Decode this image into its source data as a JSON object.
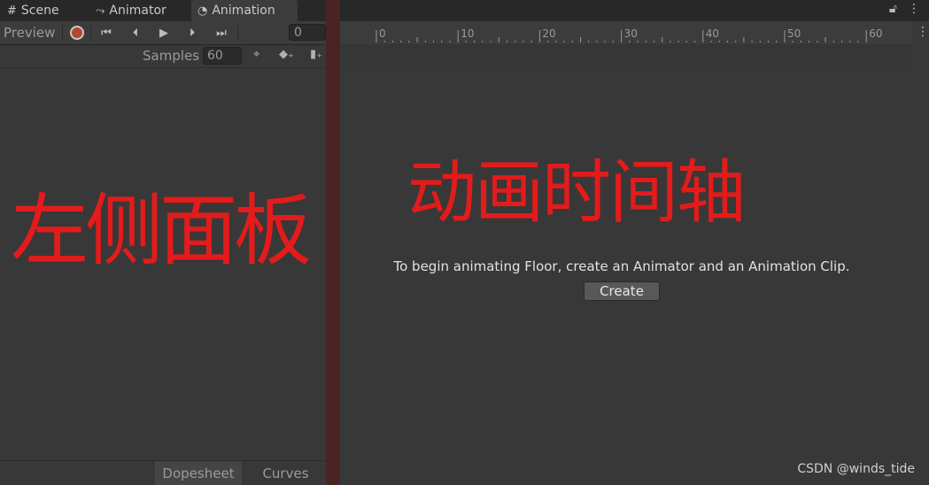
{
  "tabs": [
    {
      "label": "Scene",
      "icon": "grid-icon"
    },
    {
      "label": "Animator",
      "icon": "animator-icon"
    },
    {
      "label": "Animation",
      "icon": "clock-icon"
    }
  ],
  "toolbar": {
    "preview_label": "Preview",
    "frame_value": "0"
  },
  "samples": {
    "label": "Samples",
    "value": "60"
  },
  "ruler": {
    "labels": [
      "0",
      "10",
      "20",
      "30",
      "40",
      "50",
      "60"
    ]
  },
  "timeline": {
    "message": "To begin animating Floor, create an Animator and an Animation Clip.",
    "create_label": "Create"
  },
  "bottom_tabs": {
    "dopesheet": "Dopesheet",
    "curves": "Curves"
  },
  "annotations": {
    "left": "左侧面板",
    "right": "动画时间轴"
  },
  "watermark": "CSDN @winds_tide",
  "colors": {
    "annotation_red": "#e41b1b",
    "record_red": "#b3462d",
    "divider": "#4a2323"
  }
}
